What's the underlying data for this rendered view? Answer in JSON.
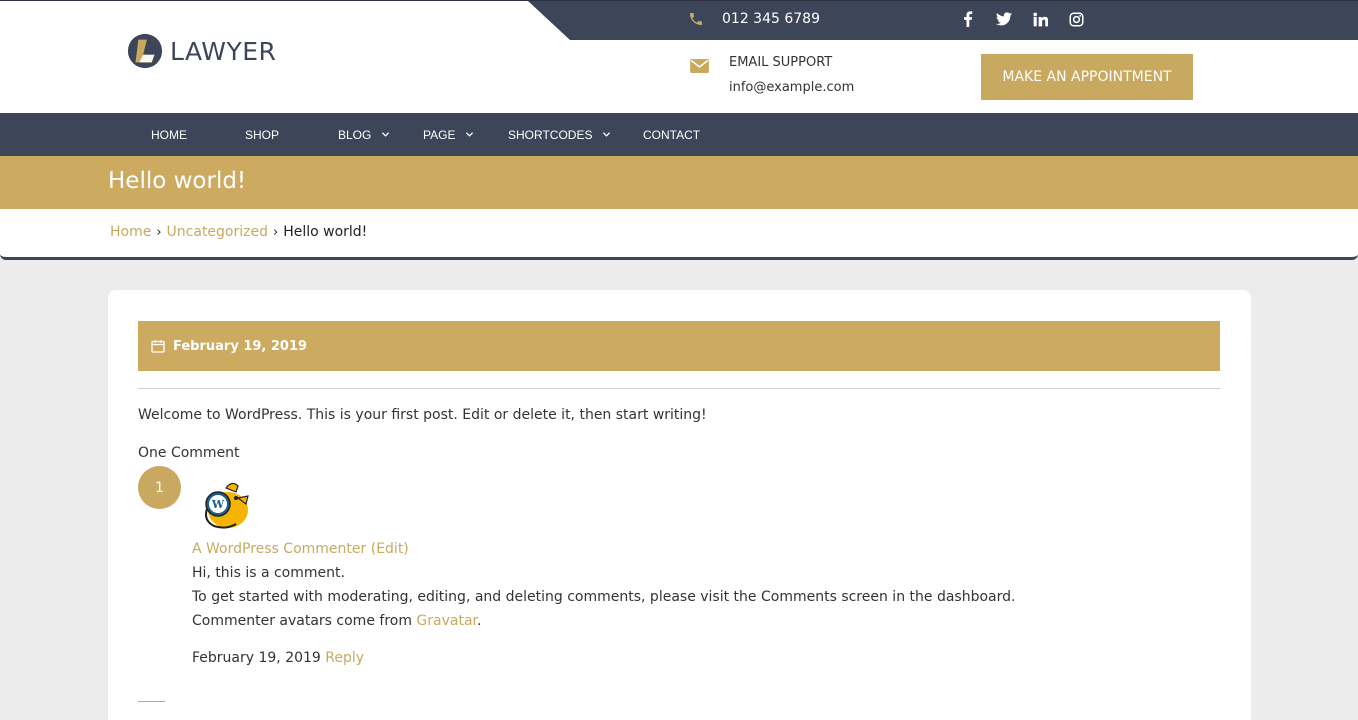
{
  "header": {
    "logo_text": "LAWYER",
    "phone": "012 345 6789",
    "email_label": "EMAIL SUPPORT",
    "email_address": "info@example.com",
    "appointment_label": "MAKE AN APPOINTMENT",
    "social_icons": [
      "facebook-icon",
      "twitter-icon",
      "linkedin-icon",
      "instagram-icon"
    ]
  },
  "nav": {
    "items": [
      {
        "label": "HOME",
        "has_dropdown": false
      },
      {
        "label": "SHOP",
        "has_dropdown": false
      },
      {
        "label": "BLOG",
        "has_dropdown": true
      },
      {
        "label": "PAGE",
        "has_dropdown": true
      },
      {
        "label": "SHORTCODES",
        "has_dropdown": true
      },
      {
        "label": "CONTACT",
        "has_dropdown": false
      }
    ]
  },
  "page": {
    "title": "Hello world!",
    "breadcrumb": [
      "Home",
      "Uncategorized",
      "Hello world!"
    ]
  },
  "post": {
    "date": "February 19, 2019",
    "body": "Welcome to WordPress. This is your first post. Edit or delete it, then start writing!",
    "comments_title": "One Comment"
  },
  "comment": {
    "number": "1",
    "author": "A WordPress Commenter",
    "edit_label": "(Edit)",
    "line1": "Hi, this is a comment.",
    "line2": "To get started with moderating, editing, and deleting comments, please visit the Comments screen in the dashboard.",
    "line3_prefix": "Commenter avatars come from ",
    "line3_link": "Gravatar",
    "line3_suffix": ".",
    "date": "February 19, 2019",
    "reply_label": "Reply"
  },
  "colors": {
    "navy": "#3d4658",
    "gold": "#c8a95f",
    "background": "#ececec"
  }
}
